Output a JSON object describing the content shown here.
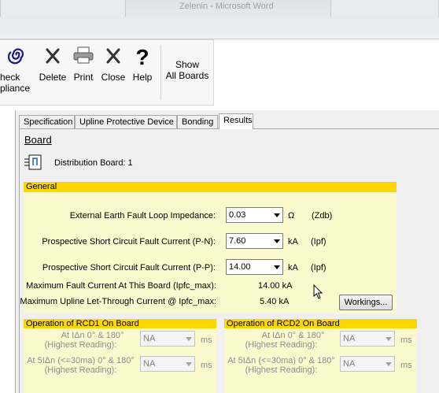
{
  "window": {
    "title": "Zelenin - Microsoft Word"
  },
  "ribbon": {
    "check_label_line1": "heck",
    "check_label_line2": "pliance",
    "delete_label": "Delete",
    "print_label": "Print",
    "close_label": "Close",
    "help_label": "Help",
    "show_label_line1": "Show",
    "show_label_line2": "All Boards"
  },
  "tabs": [
    {
      "label": "Specification"
    },
    {
      "label": "Upline Protective Device"
    },
    {
      "label": "Bonding"
    },
    {
      "label": "Results"
    }
  ],
  "board": {
    "heading": "Board",
    "name_label": "Distribution Board: 1"
  },
  "general": {
    "header": "General",
    "earth_label": "External Earth Fault Loop Impedance:",
    "earth_value": "0.03",
    "earth_unit": "Ω",
    "earth_note": "(Zdb)",
    "pn_label": "Prospective Short Circuit Fault Current (P-N):",
    "pn_value": "7.60",
    "pn_unit": "kA",
    "pn_note": "(Ipf)",
    "pp_label": "Prospective Short Circuit Fault Current (P-P):",
    "pp_value": "14.00",
    "pp_unit": "kA",
    "pp_note": "(Ipf)",
    "max_label": "Maximum Fault Current At This Board (Ipfc_max):",
    "max_value": "14.00 kA",
    "upline_label": "Maximum Upline Let-Through Current @ Ipfc_max:",
    "upline_value": "5.40 kA",
    "workings_label": "Workings..."
  },
  "rcd1": {
    "header": "Operation of RCD1 On Board",
    "row1_label_a": "At IΔn 0° & 180°",
    "row1_label_b": "(Highest Reading):",
    "row1_value": "NA",
    "row1_unit": "ms",
    "row2_label_a": "At 5IΔn (<=30ma) 0° & 180°",
    "row2_label_b": "(Highest Reading):",
    "row2_value": "NA",
    "row2_unit": "ms"
  },
  "rcd2": {
    "header": "Operation of RCD2 On Board",
    "row1_label_a": "At IΔn 0° & 180°",
    "row1_label_b": "(Highest Reading):",
    "row1_value": "NA",
    "row1_unit": "ms",
    "row2_label_a": "At 5IΔn (<=30ma) 0° & 180°",
    "row2_label_b": "(Highest Reading):",
    "row2_value": "NA",
    "row2_unit": "ms"
  },
  "colors": {
    "section_header": "#ffd700",
    "section_body": "#fbfacf",
    "window_bg": "#f0f0f0"
  }
}
